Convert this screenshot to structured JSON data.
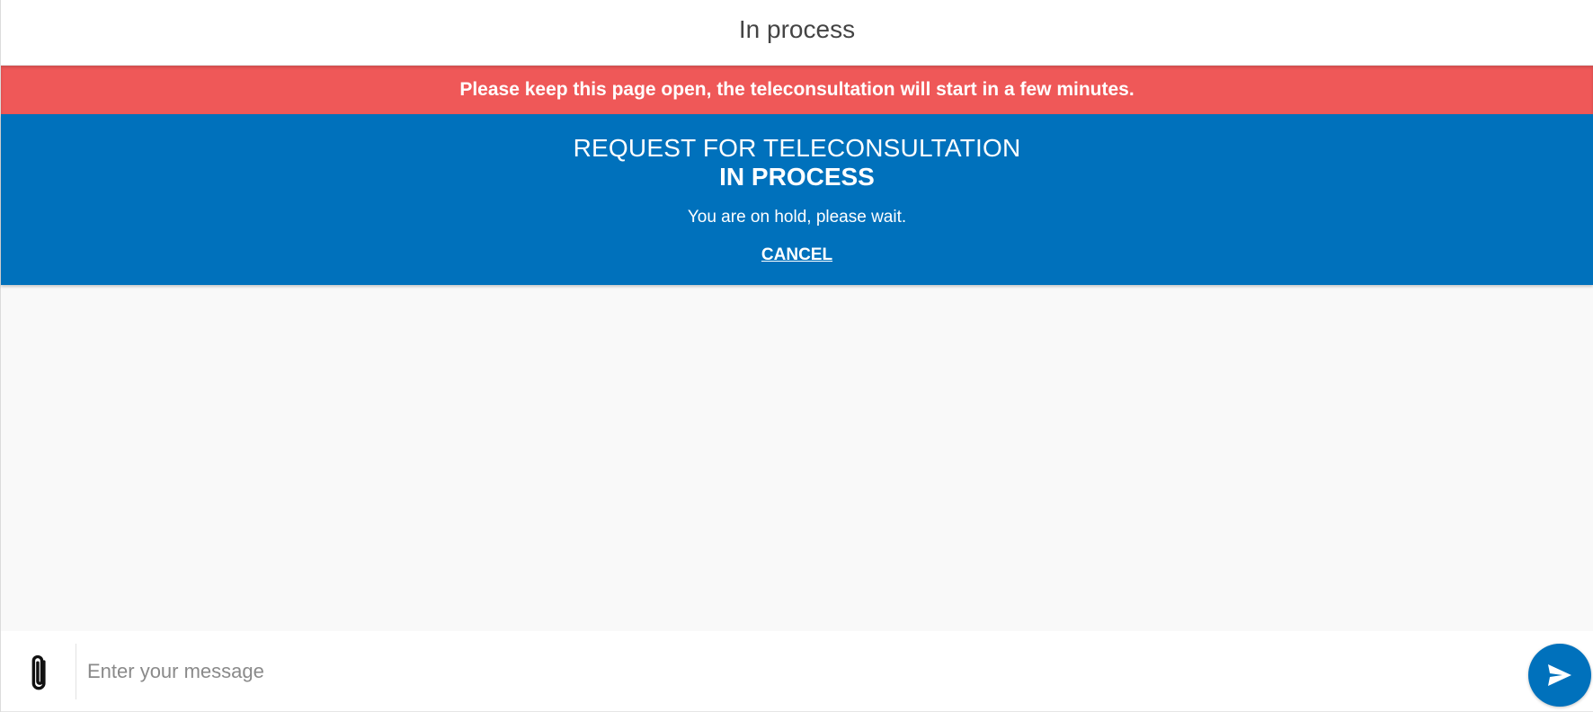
{
  "header": {
    "title": "In process"
  },
  "alert": {
    "text": "Please keep this page open, the teleconsultation will start in a few minutes."
  },
  "status": {
    "heading": "REQUEST FOR TELECONSULTATION",
    "subheading": "IN PROCESS",
    "message": "You are on hold, please wait.",
    "cancel_label": "CANCEL"
  },
  "composer": {
    "placeholder": "Enter your message",
    "value": "",
    "attach_icon": "paperclip-icon",
    "send_icon": "send-icon"
  },
  "colors": {
    "alert": "#ef5858",
    "primary": "#0071bc",
    "chat_background": "#f9f9f9"
  }
}
